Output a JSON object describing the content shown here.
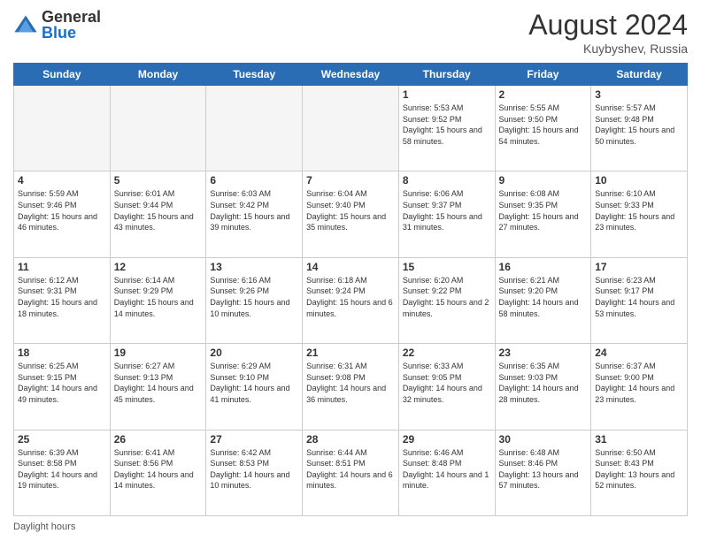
{
  "header": {
    "logo_general": "General",
    "logo_blue": "Blue",
    "month_year": "August 2024",
    "location": "Kuybyshev, Russia"
  },
  "weekdays": [
    "Sunday",
    "Monday",
    "Tuesday",
    "Wednesday",
    "Thursday",
    "Friday",
    "Saturday"
  ],
  "footer": {
    "daylight_hours": "Daylight hours"
  },
  "weeks": [
    [
      {
        "day": "",
        "sunrise": "",
        "sunset": "",
        "daylight": "",
        "empty": true
      },
      {
        "day": "",
        "sunrise": "",
        "sunset": "",
        "daylight": "",
        "empty": true
      },
      {
        "day": "",
        "sunrise": "",
        "sunset": "",
        "daylight": "",
        "empty": true
      },
      {
        "day": "",
        "sunrise": "",
        "sunset": "",
        "daylight": "",
        "empty": true
      },
      {
        "day": "1",
        "sunrise": "Sunrise: 5:53 AM",
        "sunset": "Sunset: 9:52 PM",
        "daylight": "Daylight: 15 hours and 58 minutes.",
        "empty": false
      },
      {
        "day": "2",
        "sunrise": "Sunrise: 5:55 AM",
        "sunset": "Sunset: 9:50 PM",
        "daylight": "Daylight: 15 hours and 54 minutes.",
        "empty": false
      },
      {
        "day": "3",
        "sunrise": "Sunrise: 5:57 AM",
        "sunset": "Sunset: 9:48 PM",
        "daylight": "Daylight: 15 hours and 50 minutes.",
        "empty": false
      }
    ],
    [
      {
        "day": "4",
        "sunrise": "Sunrise: 5:59 AM",
        "sunset": "Sunset: 9:46 PM",
        "daylight": "Daylight: 15 hours and 46 minutes.",
        "empty": false
      },
      {
        "day": "5",
        "sunrise": "Sunrise: 6:01 AM",
        "sunset": "Sunset: 9:44 PM",
        "daylight": "Daylight: 15 hours and 43 minutes.",
        "empty": false
      },
      {
        "day": "6",
        "sunrise": "Sunrise: 6:03 AM",
        "sunset": "Sunset: 9:42 PM",
        "daylight": "Daylight: 15 hours and 39 minutes.",
        "empty": false
      },
      {
        "day": "7",
        "sunrise": "Sunrise: 6:04 AM",
        "sunset": "Sunset: 9:40 PM",
        "daylight": "Daylight: 15 hours and 35 minutes.",
        "empty": false
      },
      {
        "day": "8",
        "sunrise": "Sunrise: 6:06 AM",
        "sunset": "Sunset: 9:37 PM",
        "daylight": "Daylight: 15 hours and 31 minutes.",
        "empty": false
      },
      {
        "day": "9",
        "sunrise": "Sunrise: 6:08 AM",
        "sunset": "Sunset: 9:35 PM",
        "daylight": "Daylight: 15 hours and 27 minutes.",
        "empty": false
      },
      {
        "day": "10",
        "sunrise": "Sunrise: 6:10 AM",
        "sunset": "Sunset: 9:33 PM",
        "daylight": "Daylight: 15 hours and 23 minutes.",
        "empty": false
      }
    ],
    [
      {
        "day": "11",
        "sunrise": "Sunrise: 6:12 AM",
        "sunset": "Sunset: 9:31 PM",
        "daylight": "Daylight: 15 hours and 18 minutes.",
        "empty": false
      },
      {
        "day": "12",
        "sunrise": "Sunrise: 6:14 AM",
        "sunset": "Sunset: 9:29 PM",
        "daylight": "Daylight: 15 hours and 14 minutes.",
        "empty": false
      },
      {
        "day": "13",
        "sunrise": "Sunrise: 6:16 AM",
        "sunset": "Sunset: 9:26 PM",
        "daylight": "Daylight: 15 hours and 10 minutes.",
        "empty": false
      },
      {
        "day": "14",
        "sunrise": "Sunrise: 6:18 AM",
        "sunset": "Sunset: 9:24 PM",
        "daylight": "Daylight: 15 hours and 6 minutes.",
        "empty": false
      },
      {
        "day": "15",
        "sunrise": "Sunrise: 6:20 AM",
        "sunset": "Sunset: 9:22 PM",
        "daylight": "Daylight: 15 hours and 2 minutes.",
        "empty": false
      },
      {
        "day": "16",
        "sunrise": "Sunrise: 6:21 AM",
        "sunset": "Sunset: 9:20 PM",
        "daylight": "Daylight: 14 hours and 58 minutes.",
        "empty": false
      },
      {
        "day": "17",
        "sunrise": "Sunrise: 6:23 AM",
        "sunset": "Sunset: 9:17 PM",
        "daylight": "Daylight: 14 hours and 53 minutes.",
        "empty": false
      }
    ],
    [
      {
        "day": "18",
        "sunrise": "Sunrise: 6:25 AM",
        "sunset": "Sunset: 9:15 PM",
        "daylight": "Daylight: 14 hours and 49 minutes.",
        "empty": false
      },
      {
        "day": "19",
        "sunrise": "Sunrise: 6:27 AM",
        "sunset": "Sunset: 9:13 PM",
        "daylight": "Daylight: 14 hours and 45 minutes.",
        "empty": false
      },
      {
        "day": "20",
        "sunrise": "Sunrise: 6:29 AM",
        "sunset": "Sunset: 9:10 PM",
        "daylight": "Daylight: 14 hours and 41 minutes.",
        "empty": false
      },
      {
        "day": "21",
        "sunrise": "Sunrise: 6:31 AM",
        "sunset": "Sunset: 9:08 PM",
        "daylight": "Daylight: 14 hours and 36 minutes.",
        "empty": false
      },
      {
        "day": "22",
        "sunrise": "Sunrise: 6:33 AM",
        "sunset": "Sunset: 9:05 PM",
        "daylight": "Daylight: 14 hours and 32 minutes.",
        "empty": false
      },
      {
        "day": "23",
        "sunrise": "Sunrise: 6:35 AM",
        "sunset": "Sunset: 9:03 PM",
        "daylight": "Daylight: 14 hours and 28 minutes.",
        "empty": false
      },
      {
        "day": "24",
        "sunrise": "Sunrise: 6:37 AM",
        "sunset": "Sunset: 9:00 PM",
        "daylight": "Daylight: 14 hours and 23 minutes.",
        "empty": false
      }
    ],
    [
      {
        "day": "25",
        "sunrise": "Sunrise: 6:39 AM",
        "sunset": "Sunset: 8:58 PM",
        "daylight": "Daylight: 14 hours and 19 minutes.",
        "empty": false
      },
      {
        "day": "26",
        "sunrise": "Sunrise: 6:41 AM",
        "sunset": "Sunset: 8:56 PM",
        "daylight": "Daylight: 14 hours and 14 minutes.",
        "empty": false
      },
      {
        "day": "27",
        "sunrise": "Sunrise: 6:42 AM",
        "sunset": "Sunset: 8:53 PM",
        "daylight": "Daylight: 14 hours and 10 minutes.",
        "empty": false
      },
      {
        "day": "28",
        "sunrise": "Sunrise: 6:44 AM",
        "sunset": "Sunset: 8:51 PM",
        "daylight": "Daylight: 14 hours and 6 minutes.",
        "empty": false
      },
      {
        "day": "29",
        "sunrise": "Sunrise: 6:46 AM",
        "sunset": "Sunset: 8:48 PM",
        "daylight": "Daylight: 14 hours and 1 minute.",
        "empty": false
      },
      {
        "day": "30",
        "sunrise": "Sunrise: 6:48 AM",
        "sunset": "Sunset: 8:46 PM",
        "daylight": "Daylight: 13 hours and 57 minutes.",
        "empty": false
      },
      {
        "day": "31",
        "sunrise": "Sunrise: 6:50 AM",
        "sunset": "Sunset: 8:43 PM",
        "daylight": "Daylight: 13 hours and 52 minutes.",
        "empty": false
      }
    ]
  ]
}
